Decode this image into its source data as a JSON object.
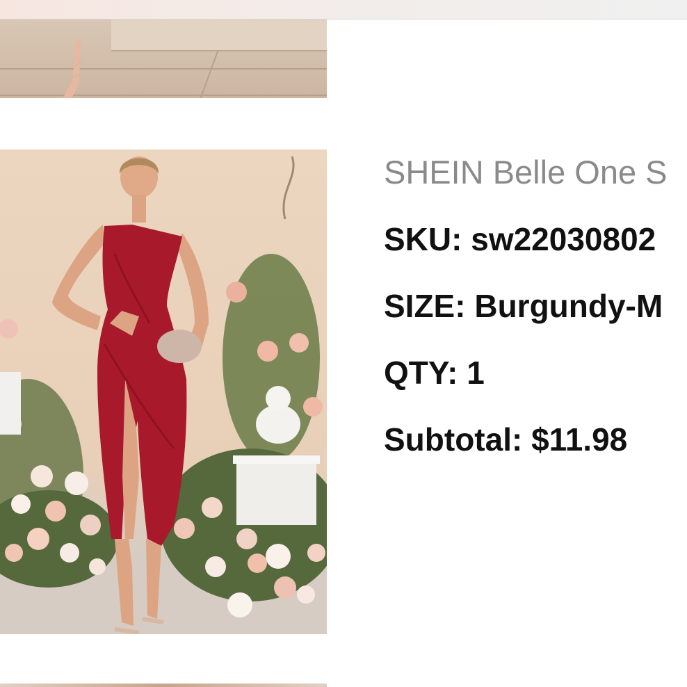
{
  "product": {
    "title": "SHEIN Belle One S",
    "sku_label": "SKU:",
    "sku_value": "sw22030802",
    "size_label": "SIZE:",
    "size_value": "Burgundy-M",
    "qty_label": "QTY:",
    "qty_value": "1",
    "subtotal_label": "Subtotal:",
    "subtotal_value": "$11.98"
  },
  "colors": {
    "dress": "#a8192b",
    "title_text": "#8a8a8a",
    "detail_text": "#111111"
  }
}
